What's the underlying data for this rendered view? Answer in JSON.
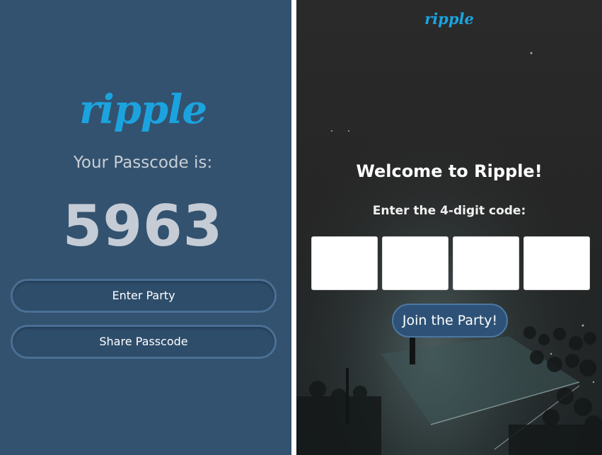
{
  "left_screen": {
    "logo": "ripple",
    "passcode_label": "Your Passcode is:",
    "passcode_value": "5963",
    "enter_party_label": "Enter Party",
    "share_passcode_label": "Share Passcode"
  },
  "right_screen": {
    "logo": "ripple",
    "welcome_title": "Welcome to Ripple!",
    "code_prompt": "Enter the 4-digit code:",
    "code_digits": [
      "",
      "",
      "",
      ""
    ],
    "join_label": "Join the Party!"
  },
  "colors": {
    "left_background": "#33526f",
    "brand_blue": "#1ba3df",
    "button_fill": "#2e5277",
    "button_border": "#4d77a1",
    "right_background": "#262626"
  }
}
